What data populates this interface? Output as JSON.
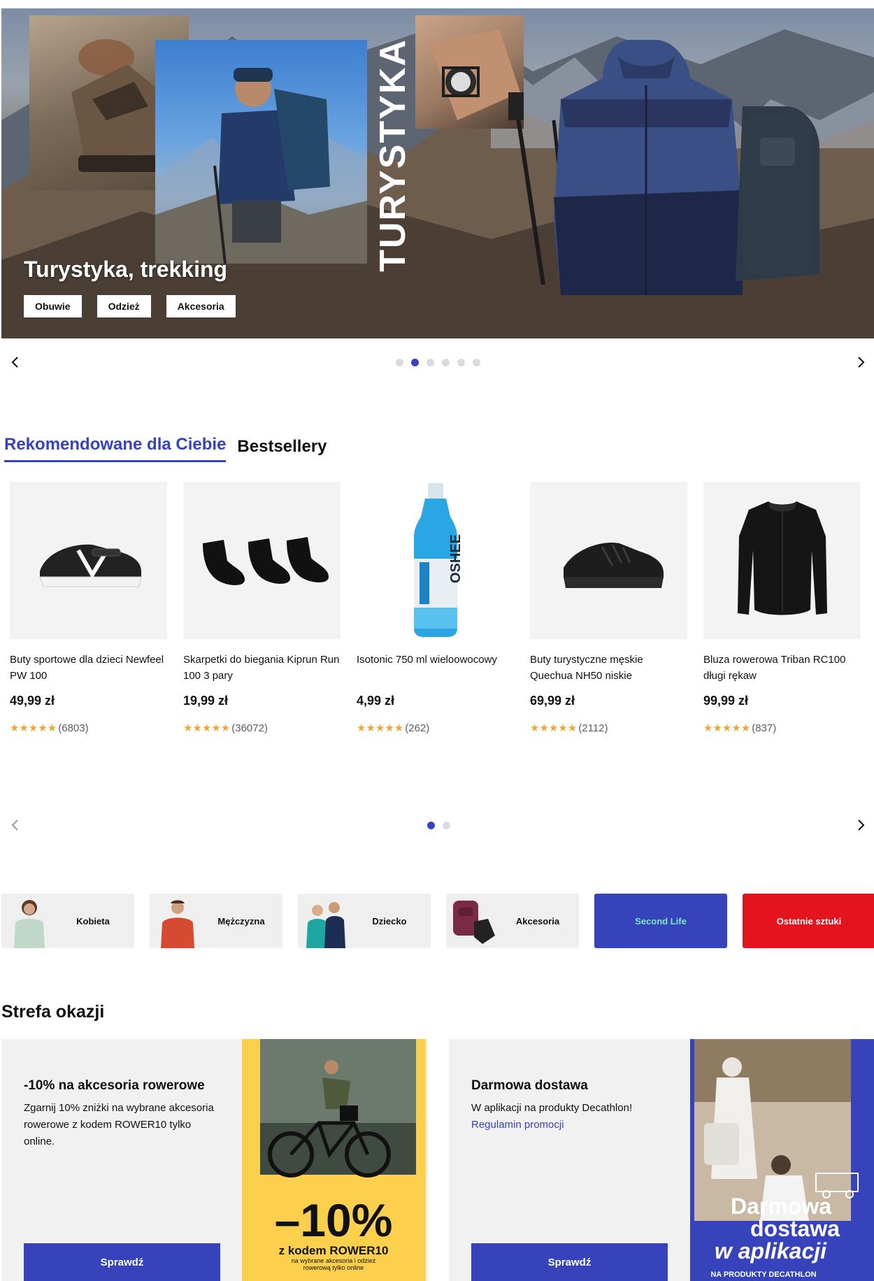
{
  "hero": {
    "vertical_text": "TURYSTYKA",
    "title": "Turystyka, trekking",
    "buttons": [
      "Obuwie",
      "Odzież",
      "Akcesoria"
    ],
    "slide_count": 6,
    "active_slide": 2
  },
  "tabs": [
    {
      "label": "Rekomendowane dla Ciebie",
      "active": true
    },
    {
      "label": "Bestsellery",
      "active": false
    }
  ],
  "products": [
    {
      "name": "Buty sportowe dla dzieci Newfeel PW 100",
      "price": "49,99 zł",
      "rating": 4.5,
      "reviews": "(6803)",
      "image": "kids-shoe-icon"
    },
    {
      "name": "Skarpetki do biegania Kiprun Run 100 3 pary",
      "price": "19,99 zł",
      "rating": 4.5,
      "reviews": "(36072)",
      "image": "socks-icon"
    },
    {
      "name": "Isotonic 750 ml wieloowocowy",
      "price": "4,99 zł",
      "rating": 5,
      "reviews": "(262)",
      "image": "bottle-icon"
    },
    {
      "name": "Buty turystyczne męskie Quechua NH50 niskie",
      "price": "69,99 zł",
      "rating": 4.5,
      "reviews": "(2112)",
      "image": "hiking-shoe-icon"
    },
    {
      "name": "Bluza rowerowa Triban RC100 długi rękaw",
      "price": "99,99 zł",
      "rating": 4.5,
      "reviews": "(837)",
      "image": "jersey-icon"
    }
  ],
  "products_pagination": {
    "pages": 2,
    "active": 1
  },
  "bottle_brand": "OSHEE",
  "categories": [
    {
      "label": "Kobieta",
      "image": "woman-icon"
    },
    {
      "label": "Mężczyzna",
      "image": "man-icon"
    },
    {
      "label": "Dziecko",
      "image": "kids-icon"
    },
    {
      "label": "Akcesoria",
      "image": "accessories-icon"
    },
    {
      "label": "Second Life",
      "image": ""
    },
    {
      "label": "Ostatnie sztuki",
      "image": ""
    }
  ],
  "deals": {
    "title": "Strefa okazji",
    "cards": [
      {
        "title": "-10% na akcesoria rowerowe",
        "description": "Zgarnij 10% zniżki na wybrane akcesoria rowerowe z kodem ROWER10 tylko online.",
        "link": "",
        "button": "Sprawdź",
        "image_big": "–10%",
        "image_code": "z kodem ROWER10",
        "image_small": "na wybrane akcesoria i odzież rowerową tylko online"
      },
      {
        "title": "Darmowa dostawa",
        "description": "W aplikacji na produkty Decathlon!",
        "link": "Regulamin promocji",
        "button": "Sprawdź",
        "image_line1": "Darmowa",
        "image_line2": "dostawa",
        "image_line3": "w aplikacji",
        "image_small": "NA PRODUKTY DECATHLON"
      }
    ]
  },
  "colors": {
    "accent": "#3643ba",
    "red": "#e3141d",
    "star": "#f2a534",
    "mint": "#7ee7c6",
    "yellow": "#fccf4c"
  }
}
